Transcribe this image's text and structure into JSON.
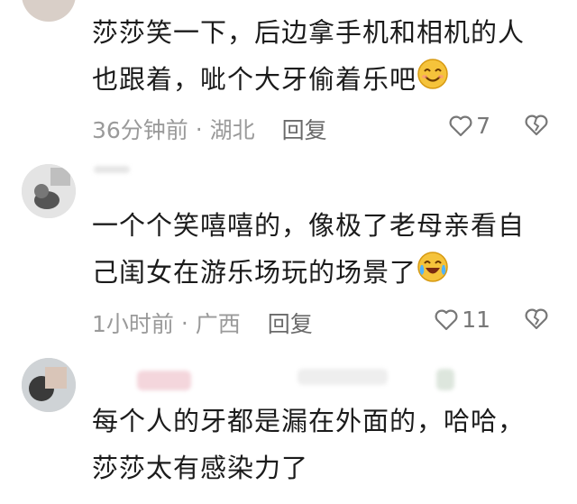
{
  "comments": [
    {
      "text_line1": "莎莎笑一下，后边拿手机和相机的人",
      "text_line2": "也跟着，呲个大牙偷着乐吧",
      "time": "36分钟前",
      "location": "湖北",
      "reply_label": "回复",
      "likes": "7"
    },
    {
      "text_line1": "一个个笑嘻嘻的，像极了老母亲看自",
      "text_line2": "己闺女在游乐场玩的场景了",
      "time": "1小时前",
      "location": "广西",
      "reply_label": "回复",
      "likes": "11"
    },
    {
      "text_line1": "每个人的牙都是漏在外面的，哈哈，",
      "text_line2": "莎莎太有感染力了"
    }
  ],
  "icons": {
    "like": "heart-outline-icon",
    "dislike": "broken-heart-icon",
    "smile_emoji": "smiling-face-emoji",
    "laugh_cry_emoji": "tears-of-joy-emoji"
  },
  "colors": {
    "meta": "#9a9a9a",
    "text": "#1b1b1b",
    "emoji": "#f5c33b"
  }
}
